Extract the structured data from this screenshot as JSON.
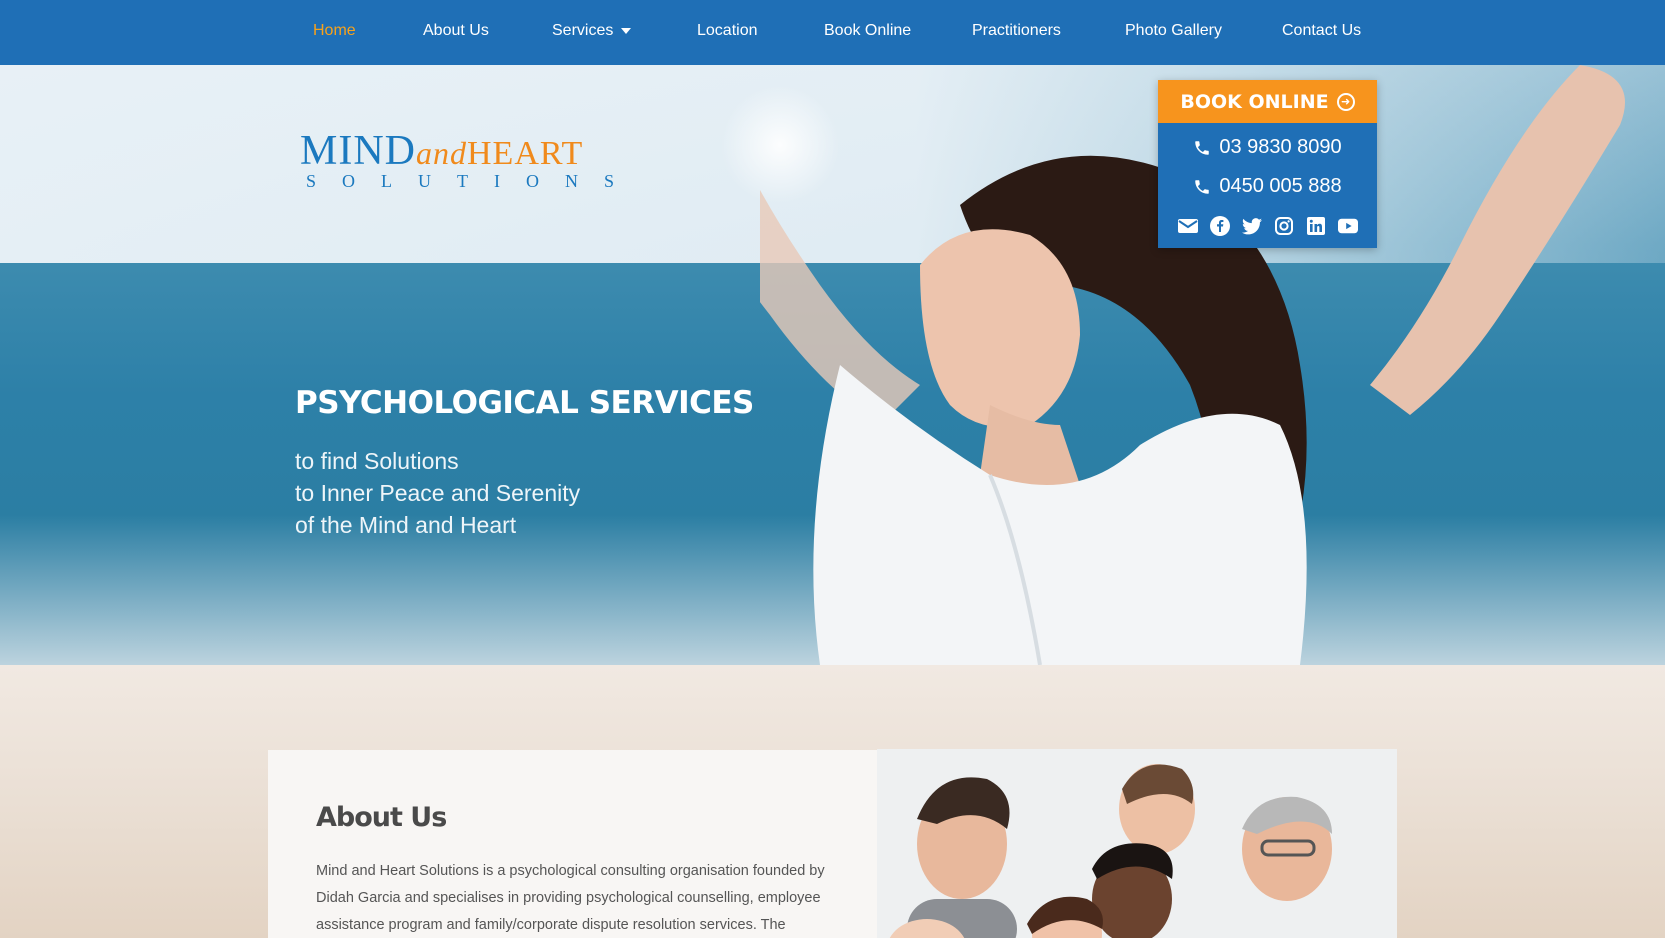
{
  "nav": {
    "items": [
      {
        "label": "Home",
        "active": true
      },
      {
        "label": "About Us"
      },
      {
        "label": "Services",
        "dropdown": true
      },
      {
        "label": "Location"
      },
      {
        "label": "Book Online"
      },
      {
        "label": "Practitioners"
      },
      {
        "label": "Photo Gallery"
      },
      {
        "label": "Contact Us"
      }
    ]
  },
  "logo": {
    "mind": "MIND",
    "and": "and",
    "heart": "HEART",
    "sub": "SOLUTIONS"
  },
  "booking": {
    "button": "BOOK ONLINE",
    "phone1": "03 9830 8090",
    "phone2": "0450 005 888",
    "socials": [
      "email-icon",
      "facebook-icon",
      "twitter-icon",
      "instagram-icon",
      "linkedin-icon",
      "youtube-icon"
    ]
  },
  "hero": {
    "title": "PSYCHOLOGICAL SERVICES",
    "lines": [
      "to find Solutions",
      "to Inner Peace and Serenity",
      "of the Mind and Heart"
    ]
  },
  "about": {
    "title": "About Us",
    "text": "Mind and Heart Solutions is a psychological consulting organisation founded by Didah Garcia and specialises in providing psychological counselling, employee assistance program and family/corporate dispute resolution services. The"
  },
  "colors": {
    "nav_bg": "#1f6fb6",
    "accent": "#f7941d",
    "active": "#f7a21b"
  }
}
